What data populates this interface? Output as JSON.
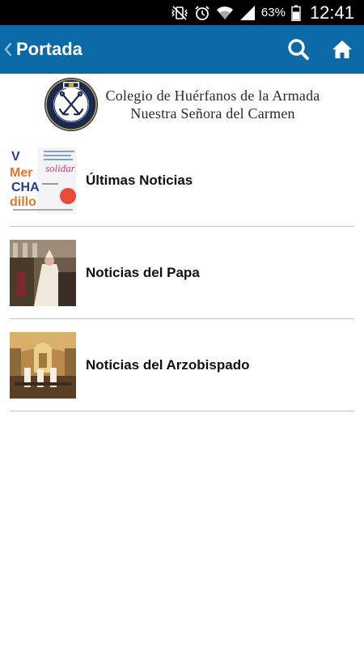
{
  "status_bar": {
    "battery_percent": "63%",
    "time": "12:41",
    "icons": [
      "vibrate-mute-icon",
      "alarm-icon",
      "wifi-icon",
      "signal-icon",
      "battery-icon"
    ]
  },
  "action_bar": {
    "title": "Portada",
    "background_color": "#0b6aa6",
    "icons": [
      "back-chevron-icon",
      "search-icon",
      "home-icon"
    ]
  },
  "logo": {
    "line1": "Colegio de Huérfanos de la Armada",
    "line2": "Nuestra Señora del Carmen"
  },
  "news_items": [
    {
      "label": "Últimas Noticias",
      "thumbnail": "merchandising-flyer-thumbnail"
    },
    {
      "label": "Noticias del Papa",
      "thumbnail": "papal-ceremony-thumbnail"
    },
    {
      "label": "Noticias del Arzobispado",
      "thumbnail": "church-interior-thumbnail"
    }
  ]
}
